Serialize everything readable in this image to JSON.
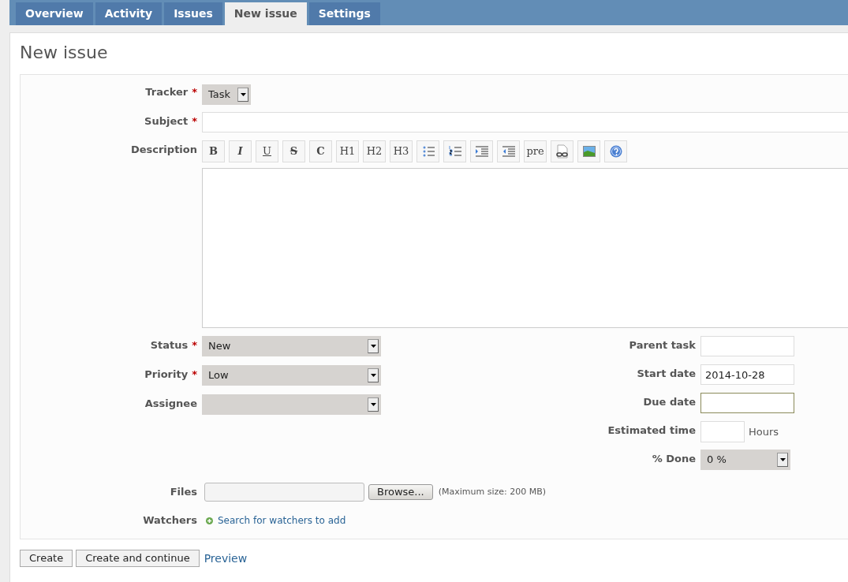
{
  "tabs": [
    {
      "label": "Overview",
      "selected": false
    },
    {
      "label": "Activity",
      "selected": false
    },
    {
      "label": "Issues",
      "selected": false
    },
    {
      "label": "New issue",
      "selected": true
    },
    {
      "label": "Settings",
      "selected": false
    }
  ],
  "title": "New issue",
  "tracker": {
    "label": "Tracker",
    "required": "*",
    "value": "Task"
  },
  "subject": {
    "label": "Subject",
    "required": "*"
  },
  "description": {
    "label": "Description",
    "toolbar": [
      {
        "kind": "bold",
        "label": "B"
      },
      {
        "kind": "italic",
        "label": "I"
      },
      {
        "kind": "underline",
        "label": "U"
      },
      {
        "kind": "strike",
        "label": "S"
      },
      {
        "kind": "code",
        "label": "C"
      },
      {
        "kind": "heading",
        "label": "H1"
      },
      {
        "kind": "heading",
        "label": "H2"
      },
      {
        "kind": "heading",
        "label": "H3"
      },
      {
        "kind": "bullets"
      },
      {
        "kind": "numbers"
      },
      {
        "kind": "indent"
      },
      {
        "kind": "outdent"
      },
      {
        "kind": "heading",
        "label": "pre"
      },
      {
        "kind": "link"
      },
      {
        "kind": "image"
      },
      {
        "kind": "help"
      }
    ]
  },
  "left_fields": [
    {
      "label": "Status",
      "required": "*",
      "value": "New"
    },
    {
      "label": "Priority",
      "required": "*",
      "value": "Low"
    },
    {
      "label": "Assignee"
    }
  ],
  "right_fields": [
    {
      "kind": "input",
      "label": "Parent task",
      "focused": false
    },
    {
      "kind": "input",
      "label": "Start date",
      "value": "2014-10-28",
      "focused": false
    },
    {
      "kind": "input",
      "label": "Due date",
      "focused": true
    },
    {
      "kind": "hours",
      "label": "Estimated time",
      "unit": "Hours"
    },
    {
      "kind": "select",
      "label": "% Done",
      "value": "0 %"
    }
  ],
  "files": {
    "label": "Files",
    "button": "Browse...",
    "note": "(Maximum size: 200 MB)"
  },
  "watchers": {
    "label": "Watchers",
    "link": "Search for watchers to add"
  },
  "buttons": [
    "Create",
    "Create and continue"
  ],
  "preview": "Preview"
}
